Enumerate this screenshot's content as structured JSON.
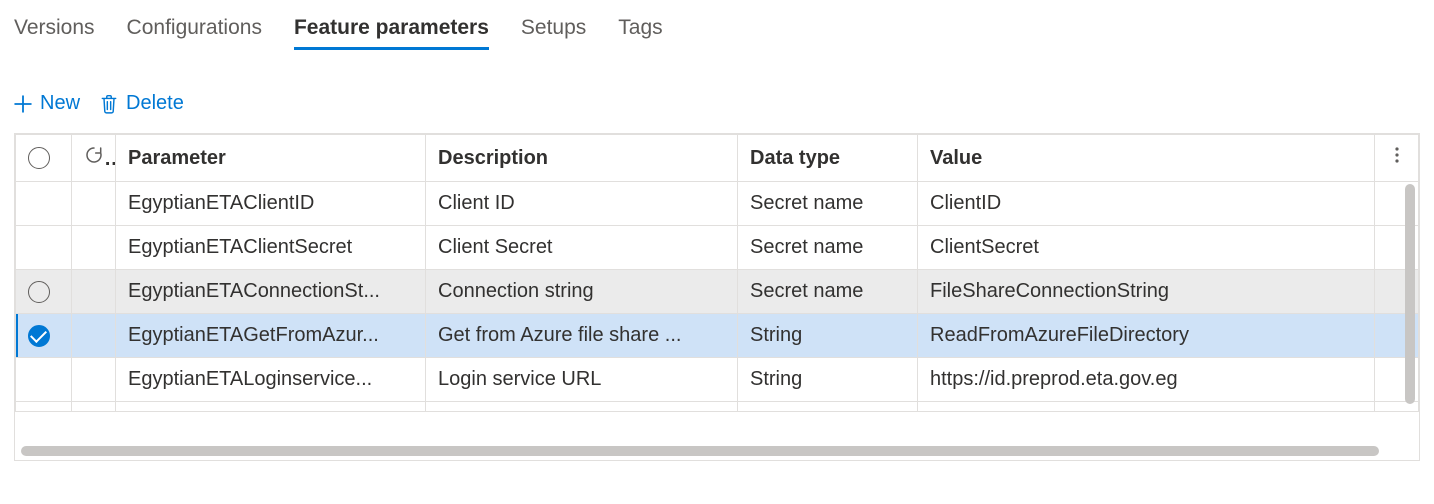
{
  "tabs": [
    {
      "label": "Versions",
      "active": false
    },
    {
      "label": "Configurations",
      "active": false
    },
    {
      "label": "Feature parameters",
      "active": true
    },
    {
      "label": "Setups",
      "active": false
    },
    {
      "label": "Tags",
      "active": false
    }
  ],
  "commands": {
    "new": "New",
    "delete": "Delete"
  },
  "grid": {
    "columns": {
      "parameter": "Parameter",
      "description": "Description",
      "data_type": "Data type",
      "value": "Value"
    },
    "rows": [
      {
        "selected": false,
        "hovered": false,
        "parameter": "EgyptianETAClientID",
        "description": "Client ID",
        "data_type": "Secret name",
        "value": "ClientID"
      },
      {
        "selected": false,
        "hovered": false,
        "parameter": "EgyptianETAClientSecret",
        "description": "Client Secret",
        "data_type": "Secret name",
        "value": "ClientSecret"
      },
      {
        "selected": false,
        "hovered": true,
        "parameter": "EgyptianETAConnectionSt...",
        "description": "Connection string",
        "data_type": "Secret name",
        "value": "FileShareConnectionString"
      },
      {
        "selected": true,
        "hovered": false,
        "parameter": "EgyptianETAGetFromAzur...",
        "description": "Get from Azure file share ...",
        "data_type": "String",
        "value": "ReadFromAzureFileDirectory"
      },
      {
        "selected": false,
        "hovered": false,
        "parameter": "EgyptianETALoginservice...",
        "description": "Login service URL",
        "data_type": "String",
        "value": "https://id.preprod.eta.gov.eg"
      }
    ]
  },
  "colors": {
    "accent": "#0078d4",
    "row_hover": "#ebebeb",
    "row_selected": "#cfe2f7",
    "border": "#e1dfdd",
    "text": "#323130",
    "muted": "#605e5c"
  }
}
